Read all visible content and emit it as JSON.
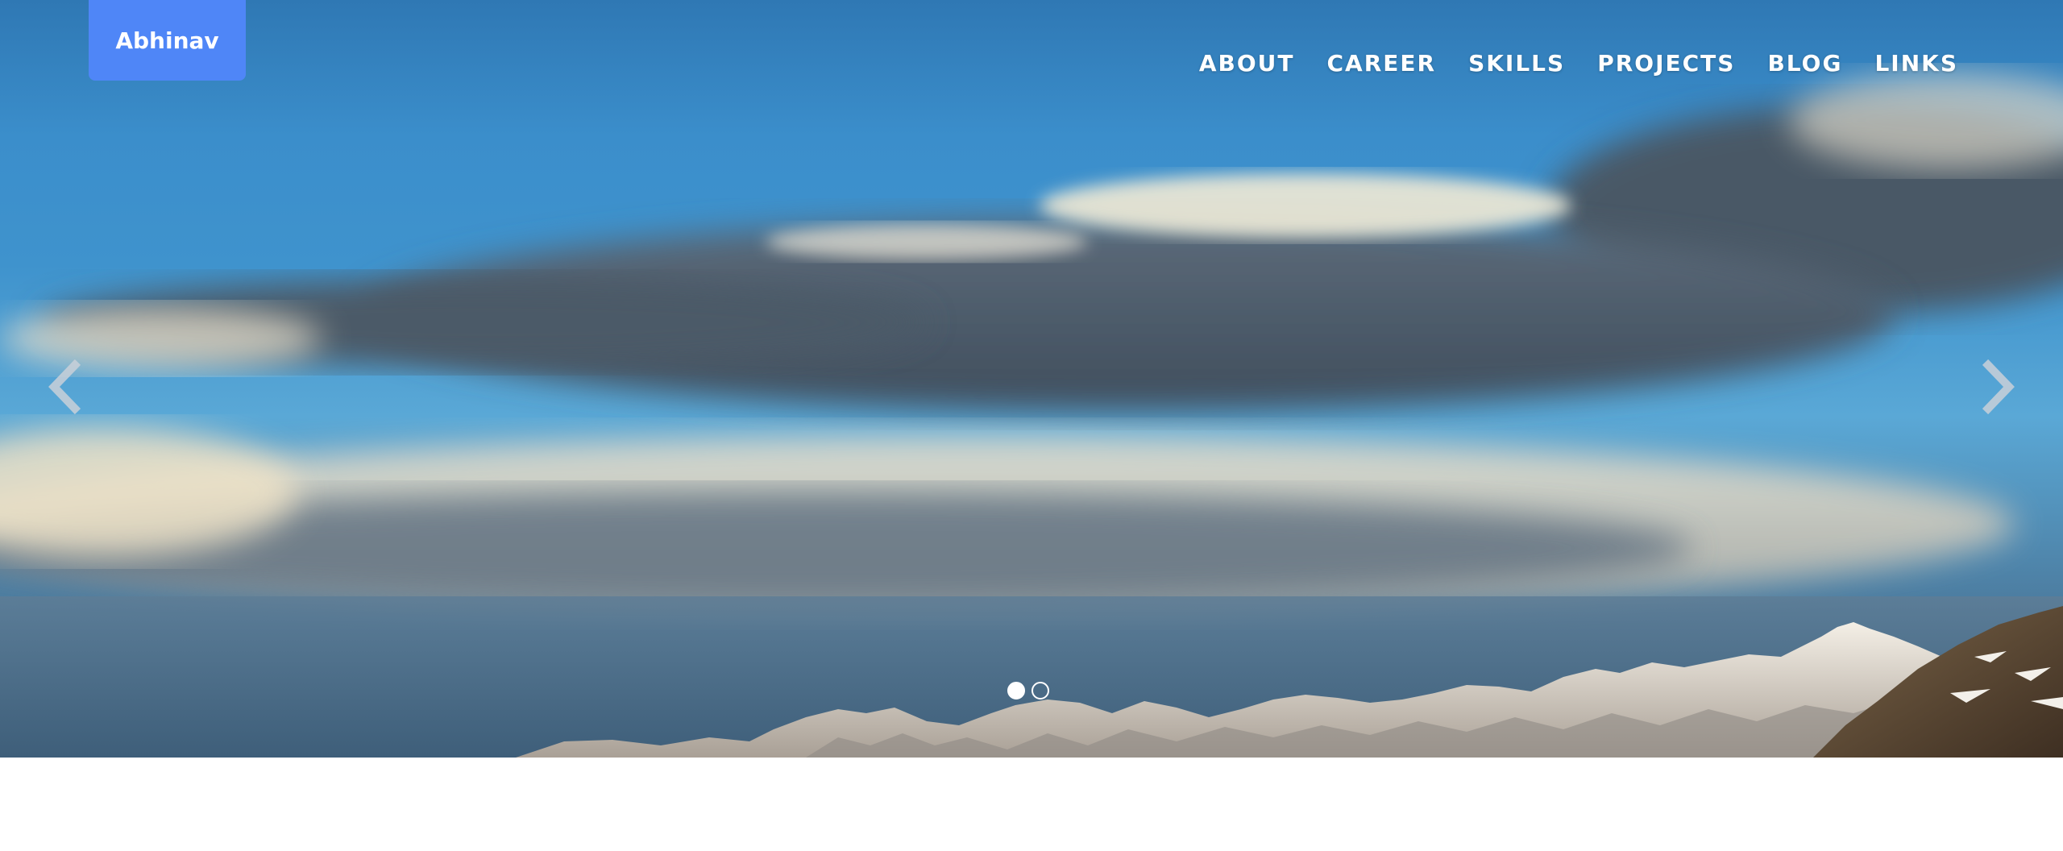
{
  "brand": {
    "label": "Abhinav"
  },
  "nav": {
    "items": [
      {
        "label": "ABOUT"
      },
      {
        "label": "CAREER"
      },
      {
        "label": "SKILLS"
      },
      {
        "label": "PROJECTS"
      },
      {
        "label": "BLOG"
      },
      {
        "label": "LINKS"
      }
    ]
  },
  "carousel": {
    "prev_icon": "chevron-left-icon",
    "next_icon": "chevron-right-icon",
    "slide_count": 2,
    "active_slide": 1
  },
  "colors": {
    "brand_bg": "#4f86f7",
    "nav_text": "#ffffff",
    "sky": "#3f93cd"
  }
}
